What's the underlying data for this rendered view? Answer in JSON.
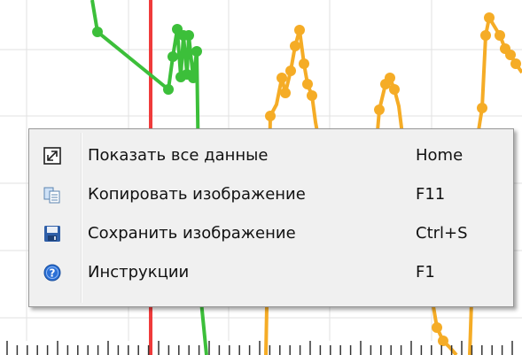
{
  "plot": {
    "background": "#ffffff",
    "grid_color": "#e0e0e0",
    "series": [
      {
        "color": "#3cbf3a"
      },
      {
        "color": "#f5ac26"
      }
    ],
    "marker_line_color": "#ef3b3b"
  },
  "context_menu": {
    "items": [
      {
        "icon": "fit-all-icon",
        "label": "Показать все данные",
        "shortcut": "Home"
      },
      {
        "icon": "copy-image-icon",
        "label": "Копировать изображение",
        "shortcut": "F11"
      },
      {
        "icon": "save-disk-icon",
        "label": "Сохранить изображение",
        "shortcut": "Ctrl+S"
      },
      {
        "icon": "help-icon",
        "label": "Инструкции",
        "shortcut": "F1"
      }
    ]
  }
}
